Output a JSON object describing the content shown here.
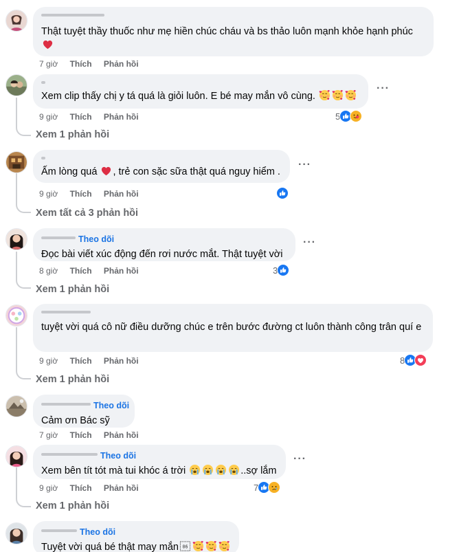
{
  "colors": {
    "bubble": "#f0f2f5",
    "link": "#1b74e4",
    "meta": "#65676b",
    "like_blue": "#1877f2",
    "heart_red": "#f33e58"
  },
  "labels": {
    "like": "Thích",
    "reply": "Phản hồi",
    "follow": "Theo dõi"
  },
  "comments": [
    {
      "time": "7 giờ",
      "text": "Thật tuyệt thầy thuốc như mẹ hiền chúc cháu và bs thảo luôn mạnh khỏe hạnh phúc",
      "emoji_after": [
        "heart"
      ]
    },
    {
      "time": "9 giờ",
      "text": "Xem clip thấy chị y tá quá là giỏi luôn. E bé may mắn vô cùng.",
      "emoji_after": [
        "love-face",
        "love-face",
        "love-face"
      ],
      "reaction_count": "5",
      "reactions": [
        "like-icon",
        "care-icon"
      ],
      "view_replies": "Xem 1 phản hồi"
    },
    {
      "time": "9 giờ",
      "text_a": "Ấm lòng quá",
      "text_b": ", trẻ con sặc sữa thật quá nguy hiểm .",
      "reactions": [
        "like-icon"
      ],
      "view_replies": "Xem tất cả 3 phản hồi"
    },
    {
      "time": "8 giờ",
      "text": "Đọc bài viết xúc động đến rơi nước mắt. Thật tuyệt vời",
      "follow": true,
      "reaction_count": "3",
      "reactions": [
        "like-icon"
      ],
      "view_replies": "Xem 1 phản hồi"
    },
    {
      "time": "9 giờ",
      "text": "tuyệt vời quá cô nữ điều dưỡng chúc e trên bước đường ct luôn thành công trân quí e",
      "reaction_count": "8",
      "reactions": [
        "like-icon",
        "love-icon"
      ],
      "view_replies": "Xem 1 phản hồi"
    },
    {
      "time": "7 giờ",
      "text": "Cảm ơn Bác sỹ",
      "follow": true
    },
    {
      "time": "9 giờ",
      "text_a": "Xem bên tít tót mà tui khóc á trời",
      "text_b": "..sợ lắm",
      "follow": true,
      "reaction_count": "7",
      "reactions": [
        "like-icon",
        "sad-icon"
      ],
      "view_replies": "Xem 1 phản hồi"
    },
    {
      "text": "Tuyệt vời quá bé thật may mắn",
      "follow": true
    }
  ]
}
